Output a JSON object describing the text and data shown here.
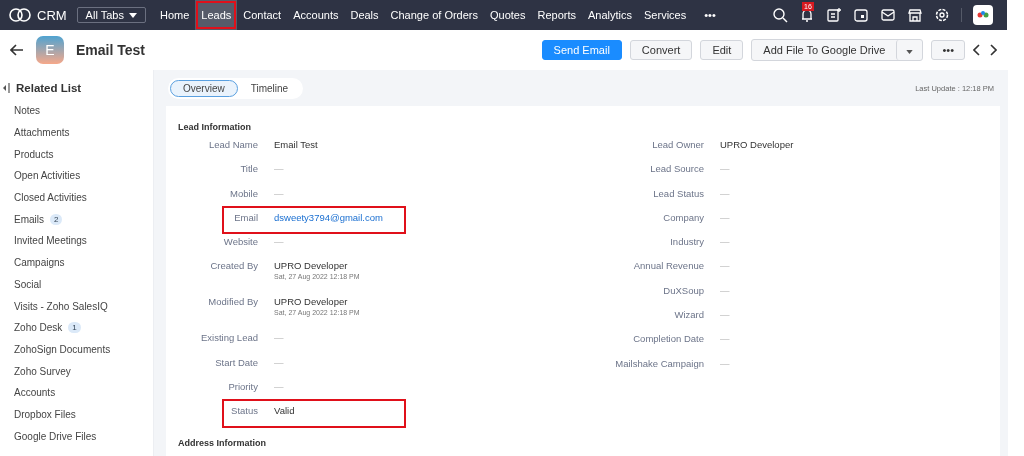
{
  "topbar": {
    "brand": "CRM",
    "all_tabs": "All Tabs",
    "nav": [
      {
        "label": "Home",
        "selected": false,
        "highlighted": false
      },
      {
        "label": "Leads",
        "selected": true,
        "highlighted": true
      },
      {
        "label": "Contact",
        "selected": false,
        "highlighted": false
      },
      {
        "label": "Accounts",
        "selected": false,
        "highlighted": false
      },
      {
        "label": "Deals",
        "selected": false,
        "highlighted": false
      },
      {
        "label": "Change of Orders",
        "selected": false,
        "highlighted": false
      },
      {
        "label": "Quotes",
        "selected": false,
        "highlighted": false
      },
      {
        "label": "Reports",
        "selected": false,
        "highlighted": false
      },
      {
        "label": "Analytics",
        "selected": false,
        "highlighted": false
      },
      {
        "label": "Services",
        "selected": false,
        "highlighted": false
      }
    ],
    "more": "•••",
    "notification_count": "16"
  },
  "record": {
    "avatar_letter": "E",
    "title": "Email Test",
    "actions": [
      "Send Email",
      "Convert",
      "Edit",
      "Add File To Google Drive"
    ],
    "more": "•••"
  },
  "sidebar": {
    "title": "Related List",
    "items": [
      {
        "label": "Notes"
      },
      {
        "label": "Attachments"
      },
      {
        "label": "Products"
      },
      {
        "label": "Open Activities"
      },
      {
        "label": "Closed Activities"
      },
      {
        "label": "Emails",
        "count": "2"
      },
      {
        "label": "Invited Meetings"
      },
      {
        "label": "Campaigns"
      },
      {
        "label": "Social"
      },
      {
        "label": "Visits - Zoho SalesIQ"
      },
      {
        "label": "Zoho Desk",
        "count": "1"
      },
      {
        "label": "ZohoSign Documents"
      },
      {
        "label": "Zoho Survey"
      },
      {
        "label": "Accounts"
      },
      {
        "label": "Dropbox Files"
      },
      {
        "label": "Google Drive Files"
      }
    ]
  },
  "tabs": [
    {
      "label": "Overview",
      "selected": true
    },
    {
      "label": "Timeline",
      "selected": false
    }
  ],
  "last_update": "Last Update : 12:18 PM",
  "section_title": "Lead Information",
  "left_fields": [
    {
      "label": "Lead Name",
      "value": "Email Test",
      "kind": "text",
      "highlighted": false
    },
    {
      "label": "Title",
      "value": "—",
      "kind": "empty",
      "highlighted": false
    },
    {
      "label": "Mobile",
      "value": "—",
      "kind": "empty",
      "highlighted": false
    },
    {
      "label": "Email",
      "value": "dsweety3794@gmail.com",
      "kind": "link",
      "highlighted": true
    },
    {
      "label": "Website",
      "value": "—",
      "kind": "empty",
      "highlighted": false
    },
    {
      "label": "Created By",
      "value": "UPRO Developer",
      "sub": "Sat, 27 Aug 2022 12:18 PM",
      "kind": "text",
      "highlighted": false
    },
    {
      "label": "Modified By",
      "value": "UPRO Developer",
      "sub": "Sat, 27 Aug 2022 12:18 PM",
      "kind": "text",
      "highlighted": false
    },
    {
      "label": "Existing Lead",
      "value": "—",
      "kind": "empty",
      "highlighted": false
    },
    {
      "label": "Start Date",
      "value": "—",
      "kind": "empty",
      "highlighted": false
    },
    {
      "label": "Priority",
      "value": "—",
      "kind": "empty",
      "highlighted": false
    },
    {
      "label": "Status",
      "value": "Valid",
      "kind": "text",
      "highlighted": true
    }
  ],
  "right_fields": [
    {
      "label": "Lead Owner",
      "value": "UPRO Developer",
      "kind": "text"
    },
    {
      "label": "Lead Source",
      "value": "—",
      "kind": "empty"
    },
    {
      "label": "Lead Status",
      "value": "—",
      "kind": "empty"
    },
    {
      "label": "Company",
      "value": "—",
      "kind": "empty"
    },
    {
      "label": "Industry",
      "value": "—",
      "kind": "empty"
    },
    {
      "label": "Annual Revenue",
      "value": "—",
      "kind": "empty"
    },
    {
      "label": "DuXSoup",
      "value": "—",
      "kind": "empty"
    },
    {
      "label": "Wizard",
      "value": "—",
      "kind": "empty"
    },
    {
      "label": "Completion Date",
      "value": "—",
      "kind": "empty"
    },
    {
      "label": "Mailshake Campaign",
      "value": "—",
      "kind": "empty"
    }
  ],
  "next_section_title": "Address Information"
}
